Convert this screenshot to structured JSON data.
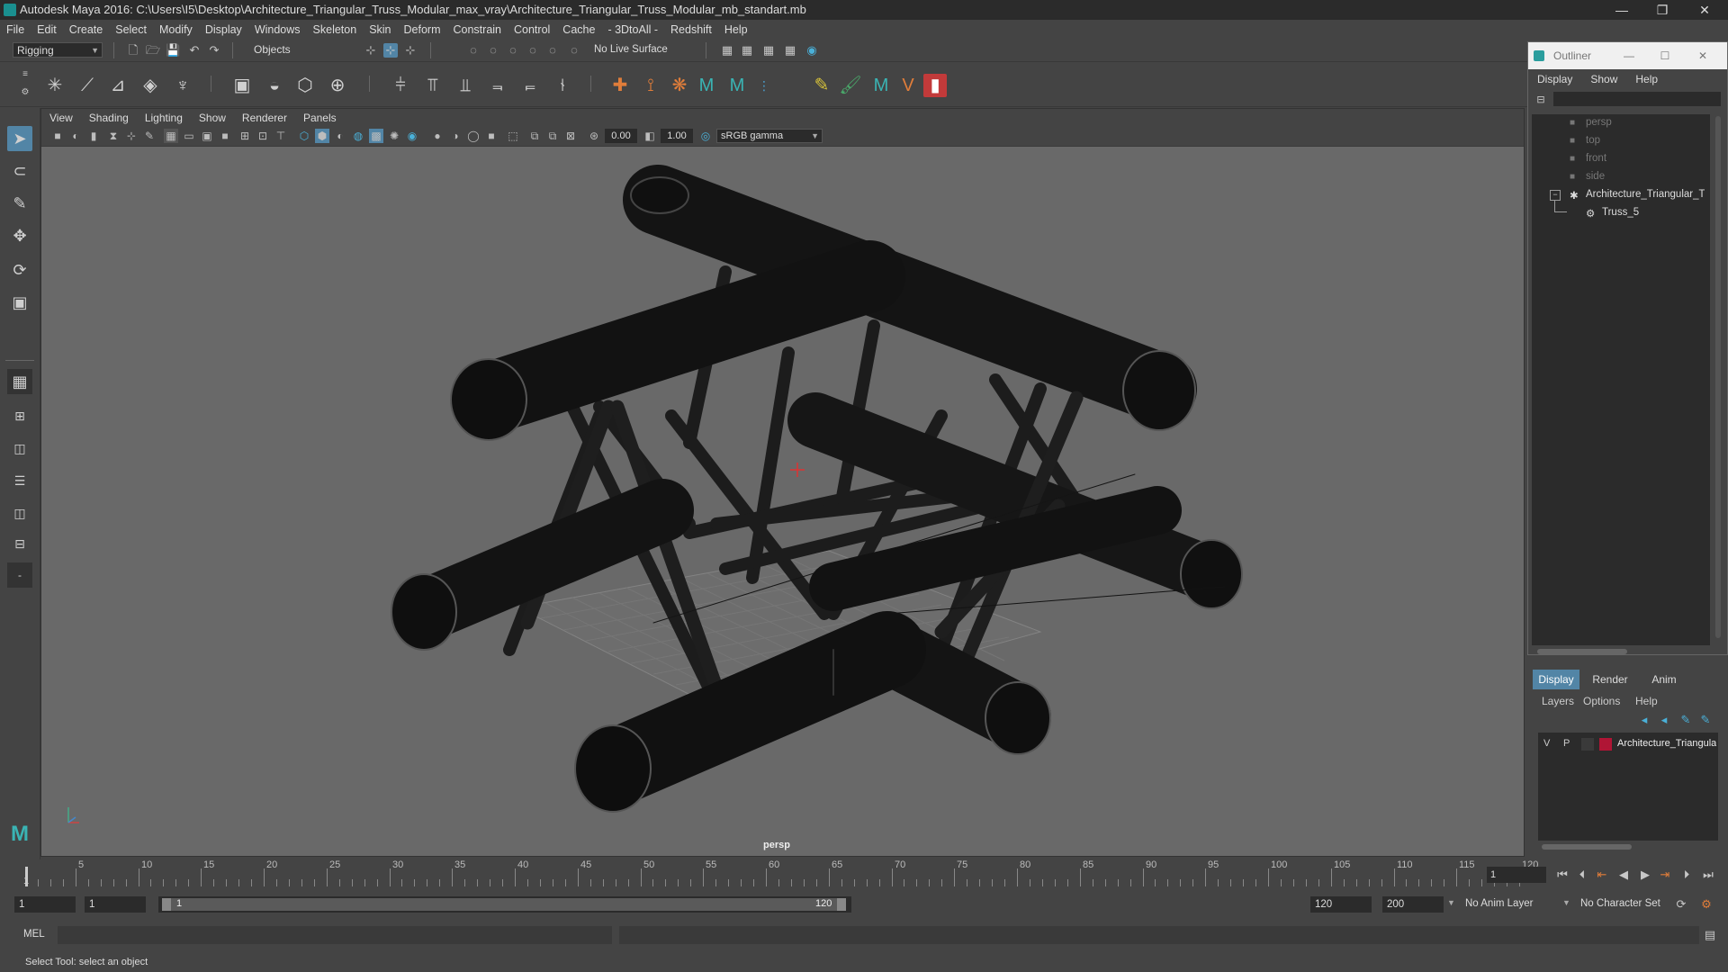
{
  "titlebar": {
    "title": "Autodesk Maya 2016: C:\\Users\\I5\\Desktop\\Architecture_Triangular_Truss_Modular_max_vray\\Architecture_Triangular_Truss_Modular_mb_standart.mb",
    "minimize": "—",
    "restore": "❐",
    "close": "✕"
  },
  "menubar": [
    "File",
    "Edit",
    "Create",
    "Select",
    "Modify",
    "Display",
    "Windows",
    "Skeleton",
    "Skin",
    "Deform",
    "Constrain",
    "Control",
    "Cache",
    "- 3DtoAll -",
    "Redshift",
    "Help"
  ],
  "statusline": {
    "mode": "Rigging",
    "selection_mode": "Objects",
    "live_surface": "No Live Surface"
  },
  "viewport": {
    "menu": [
      "View",
      "Shading",
      "Lighting",
      "Show",
      "Renderer",
      "Panels"
    ],
    "exposure": "0.00",
    "gamma": "1.00",
    "color_space": "sRGB gamma",
    "camera_label": "persp"
  },
  "outliner": {
    "title": "Outliner",
    "menu": [
      "Display",
      "Show",
      "Help"
    ],
    "items": [
      {
        "label": "persp"
      },
      {
        "label": "top"
      },
      {
        "label": "front"
      },
      {
        "label": "side"
      },
      {
        "label": "Architecture_Triangular_Tru"
      },
      {
        "label": "Truss_5"
      }
    ]
  },
  "layer_editor": {
    "tabs": [
      "Display",
      "Render",
      "Anim"
    ],
    "menu": [
      "Layers",
      "Options",
      "Help"
    ],
    "layer": {
      "v": "V",
      "p": "P",
      "name": "Architecture_Triangula",
      "color": "#b01535"
    }
  },
  "timeline": {
    "ticks": [
      "5",
      "10",
      "15",
      "20",
      "25",
      "30",
      "35",
      "40",
      "45",
      "50",
      "55",
      "60",
      "65",
      "70",
      "75",
      "80",
      "85",
      "90",
      "95",
      "100",
      "105",
      "110",
      "115",
      "120"
    ],
    "start_label": "1",
    "current_frame": "1"
  },
  "range": {
    "start": "1",
    "current": "1",
    "slider_start": "1",
    "slider_end": "120",
    "end": "120",
    "max": "200",
    "anim_layer": "No Anim Layer",
    "character_set": "No Character Set"
  },
  "cmdline": {
    "label": "MEL"
  },
  "helpline": {
    "text": "Select Tool: select an object"
  }
}
